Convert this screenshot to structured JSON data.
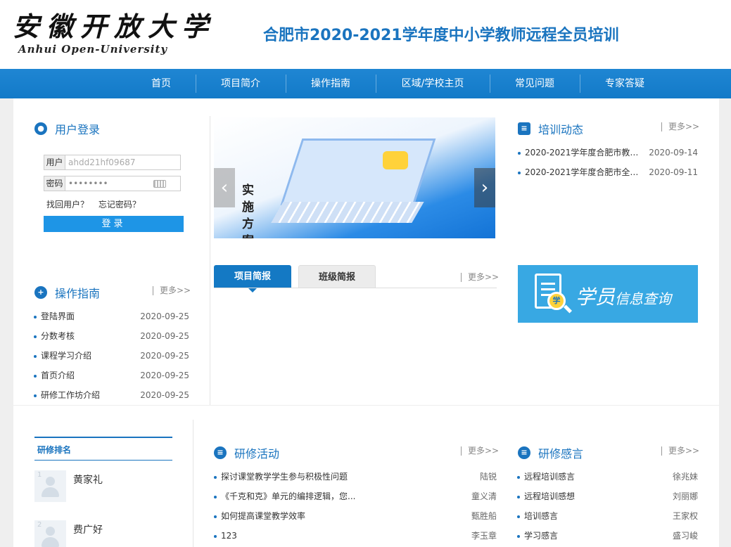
{
  "header": {
    "logo_cn": "安徽开放大学",
    "logo_en": "Anhui Open-University",
    "site_title": "合肥市2020-2021学年度中小学教师远程全员培训"
  },
  "nav": [
    "首页",
    "项目简介",
    "操作指南",
    "区域/学校主页",
    "常见问题",
    "专家答疑"
  ],
  "login": {
    "title": "用户登录",
    "user_label": "用户",
    "user_value": "ahdd21hf09687",
    "password_label": "密码",
    "password_value": "••••••••",
    "find_user": "找回用户？",
    "forgot_password": "忘记密码？",
    "submit": "登录"
  },
  "guide": {
    "title": "操作指南",
    "more": "更多>>",
    "items": [
      {
        "text": "登陆界面",
        "date": "2020-09-25"
      },
      {
        "text": "分数考核",
        "date": "2020-09-25"
      },
      {
        "text": "课程学习介绍",
        "date": "2020-09-25"
      },
      {
        "text": "首页介绍",
        "date": "2020-09-25"
      },
      {
        "text": "研修工作坊介绍",
        "date": "2020-09-25"
      }
    ]
  },
  "banner": {
    "text": "实施方案",
    "prev": "‹",
    "next": "›"
  },
  "tabs": {
    "active": "项目简报",
    "idle": "班级简报",
    "more": "更多>>"
  },
  "news": {
    "title": "培训动态",
    "more": "更多>>",
    "items": [
      {
        "text": "2020-2021学年度合肥市教师...",
        "date": "2020-09-14"
      },
      {
        "text": "2020-2021学年度合肥市全员...",
        "date": "2020-09-11"
      }
    ]
  },
  "query_banner": {
    "big": "学员",
    "small": "信息查询",
    "lens": "学"
  },
  "ranking": {
    "title": "研修排名",
    "items": [
      {
        "num": "1",
        "name": "黄家礼"
      },
      {
        "num": "2",
        "name": "费广好"
      }
    ]
  },
  "activities": {
    "title": "研修活动",
    "more": "更多>>",
    "items": [
      {
        "text": "探讨课堂教学学生参与积极性问题",
        "author": "陆锐"
      },
      {
        "text": "《千克和克》单元的编排逻辑，您...",
        "author": "童义清"
      },
      {
        "text": "如何提高课堂教学效率",
        "author": "甄胜船"
      },
      {
        "text": "123",
        "author": "李玉章"
      }
    ]
  },
  "reflections": {
    "title": "研修感言",
    "more": "更多>>",
    "items": [
      {
        "text": "远程培训感言",
        "author": "徐兆妹"
      },
      {
        "text": "远程培训感想",
        "author": "刘丽娜"
      },
      {
        "text": "培训感言",
        "author": "王家权"
      },
      {
        "text": "学习感言",
        "author": "盛习峻"
      }
    ]
  },
  "colors": {
    "brand": "#1a74bf",
    "nav": "#1481cd",
    "button": "#1e95e6",
    "query_bg": "#38a8e3"
  }
}
